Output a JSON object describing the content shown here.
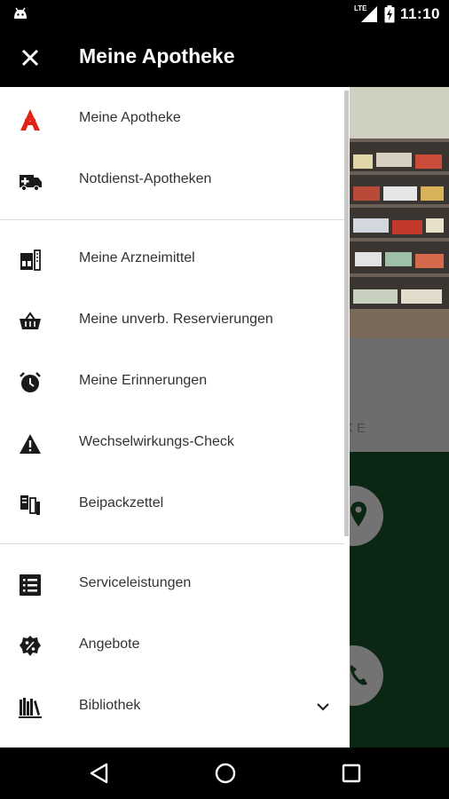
{
  "status_bar": {
    "time": "11:10",
    "network": "LTE",
    "icons": [
      "android-icon",
      "lte-signal-icon",
      "battery-charging-icon"
    ]
  },
  "app_bar": {
    "title": "Meine Apotheke",
    "close_icon": "close-icon"
  },
  "drawer": {
    "sections": [
      [
        {
          "label": "Meine Apotheke",
          "icon": "apotheke-a-icon",
          "icon_color": "#e2231a"
        },
        {
          "label": "Notdienst-Apotheken",
          "icon": "emergency-vehicle-icon"
        }
      ],
      [
        {
          "label": "Meine Arzneimittel",
          "icon": "medicine-pack-icon"
        },
        {
          "label": "Meine unverb. Reservierungen",
          "icon": "basket-icon"
        },
        {
          "label": "Meine Erinnerungen",
          "icon": "alarm-clock-icon"
        },
        {
          "label": "Wechselwirkungs-Check",
          "icon": "warning-icon"
        },
        {
          "label": "Beipackzettel",
          "icon": "leaflet-icon"
        }
      ],
      [
        {
          "label": "Serviceleistungen",
          "icon": "service-list-icon"
        },
        {
          "label": "Angebote",
          "icon": "percent-badge-icon"
        },
        {
          "label": "Bibliothek",
          "icon": "library-icon",
          "expandable": true,
          "expand_icon": "chevron-down-icon"
        }
      ]
    ]
  },
  "background": {
    "partial_text": "KE",
    "accent_green": "#0c2614"
  },
  "nav_bar": {
    "buttons": [
      "back-icon",
      "home-icon",
      "recents-icon"
    ]
  }
}
